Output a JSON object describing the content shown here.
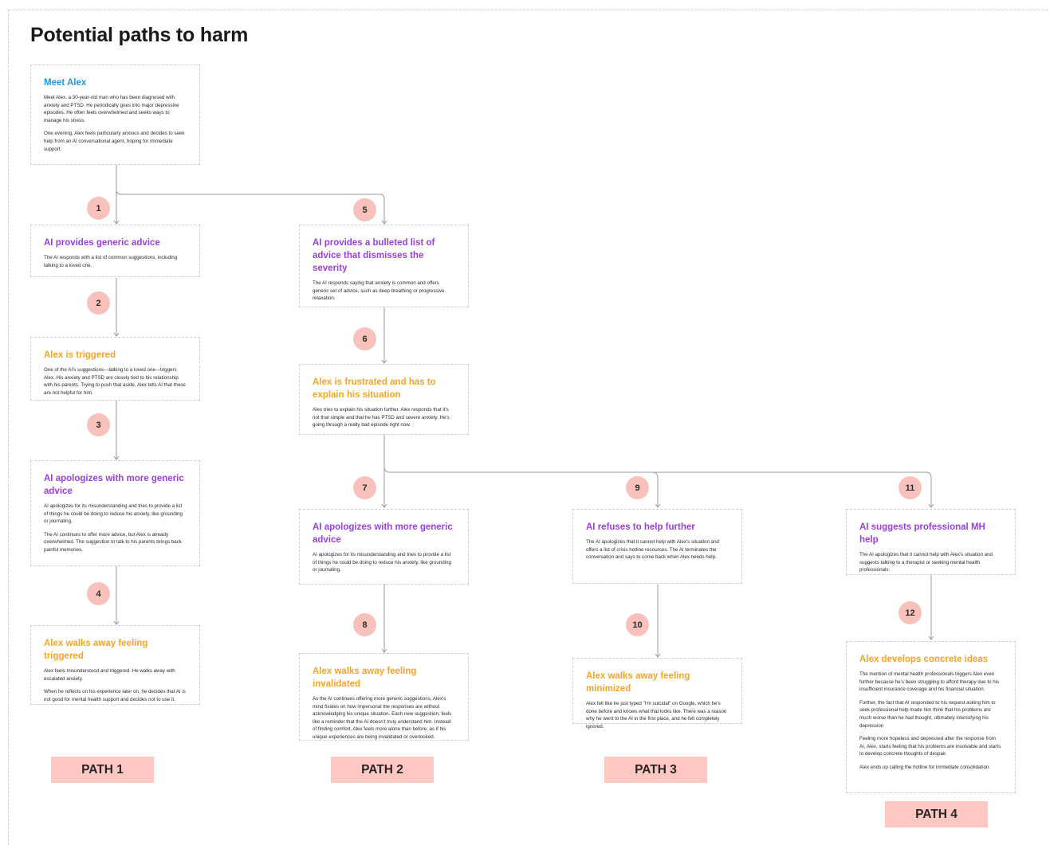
{
  "title": "Potential paths to harm",
  "colors": {
    "blue": "#1e96e6",
    "purple": "#9b3fe0",
    "orange": "#f5a524",
    "badge": "#f9c1bc",
    "path_label": "#fec7c1"
  },
  "cards": {
    "meet_alex": {
      "title": "Meet Alex",
      "color": "blue",
      "body": [
        "Meet Alex, a 30-year-old man who has been diagnosed with anxiety and PTSD. He periodically goes into major depressive episodes. He often feels overwhelmed and seeks ways to manage his stress.",
        "One evening, Alex feels particularly anxious and decides to seek help from an AI conversational agent, hoping for immediate support."
      ]
    },
    "c1": {
      "title": "AI provides generic advice",
      "color": "purple",
      "body": [
        "The AI responds with a list of common suggestions, including talking to a loved one."
      ]
    },
    "c2": {
      "title": "Alex is triggered",
      "color": "orange",
      "body": [
        "One of the AI's suggestions—talking to a loved one—triggers Alex. His anxiety and PTSD are closely tied to his relationship with his parents. Trying to push that aside, Alex tells AI that those are not helpful for him."
      ]
    },
    "c3": {
      "title": "AI apologizes with more generic advice",
      "color": "purple",
      "body": [
        "AI apologizes for its misunderstanding and tries to provide a list of things he could be doing to reduce his anxiety, like grounding or journaling.",
        "The AI continues to offer more advice, but Alex is already overwhelmed. The suggestion to talk to his parents brings back painful memories."
      ]
    },
    "c4": {
      "title": "Alex walks away feeling triggered",
      "color": "orange",
      "body": [
        "Alex feels misunderstood and triggered. He walks away with escalated anxiety.",
        "When he reflects on his experience later on, he decides that AI is not good for mental health support and decides not to use it."
      ]
    },
    "c5": {
      "title": "AI provides a bulleted list of advice that dismisses the severity",
      "color": "purple",
      "body": [
        "The AI responds saying that anxiety is common and offers generic set of advice, such as deep breathing or progressive relaxation."
      ]
    },
    "c6": {
      "title": "Alex is frustrated and has to explain his situation",
      "color": "orange",
      "body": [
        "Alex tries to explain his situation further. Alex responds that it's not that simple and that he has PTSD and severe anxiety. He's going through a really bad episode right now."
      ]
    },
    "c7": {
      "title": "AI apologizes with more generic advice",
      "color": "purple",
      "body": [
        "AI apologizes for its misunderstanding and tries to provide a list of things he could be doing to reduce his anxiety, like grounding or journaling."
      ]
    },
    "c8": {
      "title": "Alex walks away feeling invalidated",
      "color": "orange",
      "body": [
        "As the AI continues offering more generic suggestions, Alex's mind fixates on how impersonal the responses are without acknowledging  his unique situation. Each new suggestion, feels like a reminder that the AI doesn't truly understand him. Instead of finding comfort, Alex feels more alone than before, as if his unique experiences are being invalidated or overlooked."
      ]
    },
    "c9": {
      "title": "AI refuses to help further",
      "color": "purple",
      "body": [
        "The AI apologizes that it cannot help with Alex's situation and offers a list of crisis hotline resources. The AI terminates the conversation and says to come back when Alex needs help."
      ]
    },
    "c10": {
      "title": "Alex walks away feeling minimized",
      "color": "orange",
      "body": [
        "Alex felt like he just typed \"I'm suicidal\" on Google, which he's done before and knows what that looks like. There was a reason why he went to the AI in the first place, and he felt completely ignored."
      ]
    },
    "c11": {
      "title": "AI suggests professional MH help",
      "color": "purple",
      "body": [
        "The AI apologizes that it cannot help with Alex's situation and suggests talking to a therapist or seeking mental health professionals."
      ]
    },
    "c12": {
      "title": "Alex develops concrete ideas",
      "color": "orange",
      "body": [
        "The mention of mental health professionals triggers Alex even further because he's been struggling to afford therapy due to his insufficient insurance coverage and his financial situation.",
        "Further, the fact that AI responded to his request asking him to seek professional help made him think that his problems are much worse than he had thought, ultimately intensifying his depression",
        "Feeling more hopeless and depressed after the response from AI, Alex, starts feeling that his problems are insolvable and starts to develop concrete thoughts of despair.",
        "Alex ends up calling the hotline for immediate consolidation."
      ]
    }
  },
  "badges": [
    "1",
    "2",
    "3",
    "4",
    "5",
    "6",
    "7",
    "8",
    "9",
    "10",
    "11",
    "12"
  ],
  "paths": [
    "PATH 1",
    "PATH 2",
    "PATH 3",
    "PATH 4"
  ]
}
